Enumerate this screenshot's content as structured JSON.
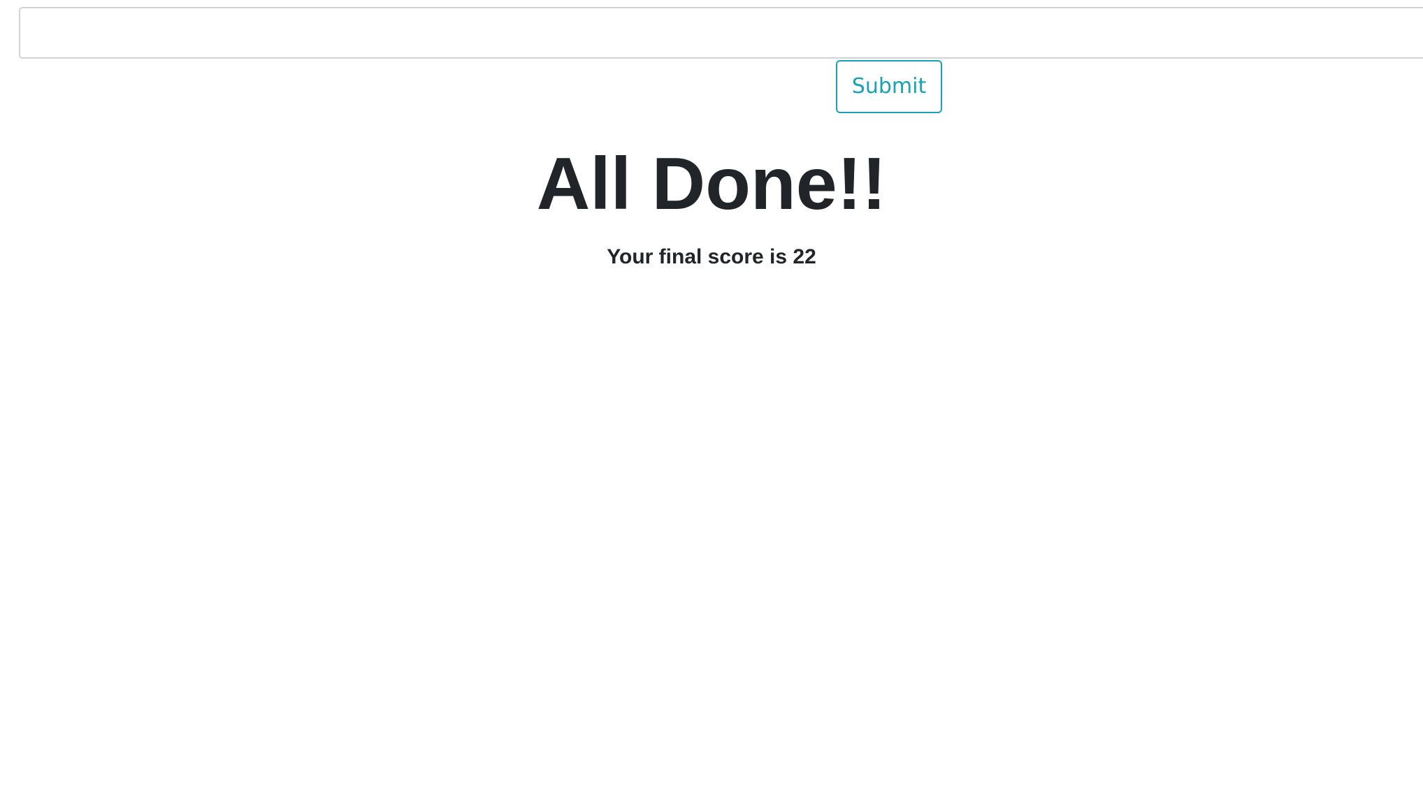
{
  "form": {
    "input_value": "",
    "submit_label": "Submit"
  },
  "result": {
    "title": "All Done!!",
    "score_text": "Your final score is 22"
  },
  "colors": {
    "accent": "#17a2b8",
    "text": "#212529",
    "input_border": "#ced4da"
  }
}
